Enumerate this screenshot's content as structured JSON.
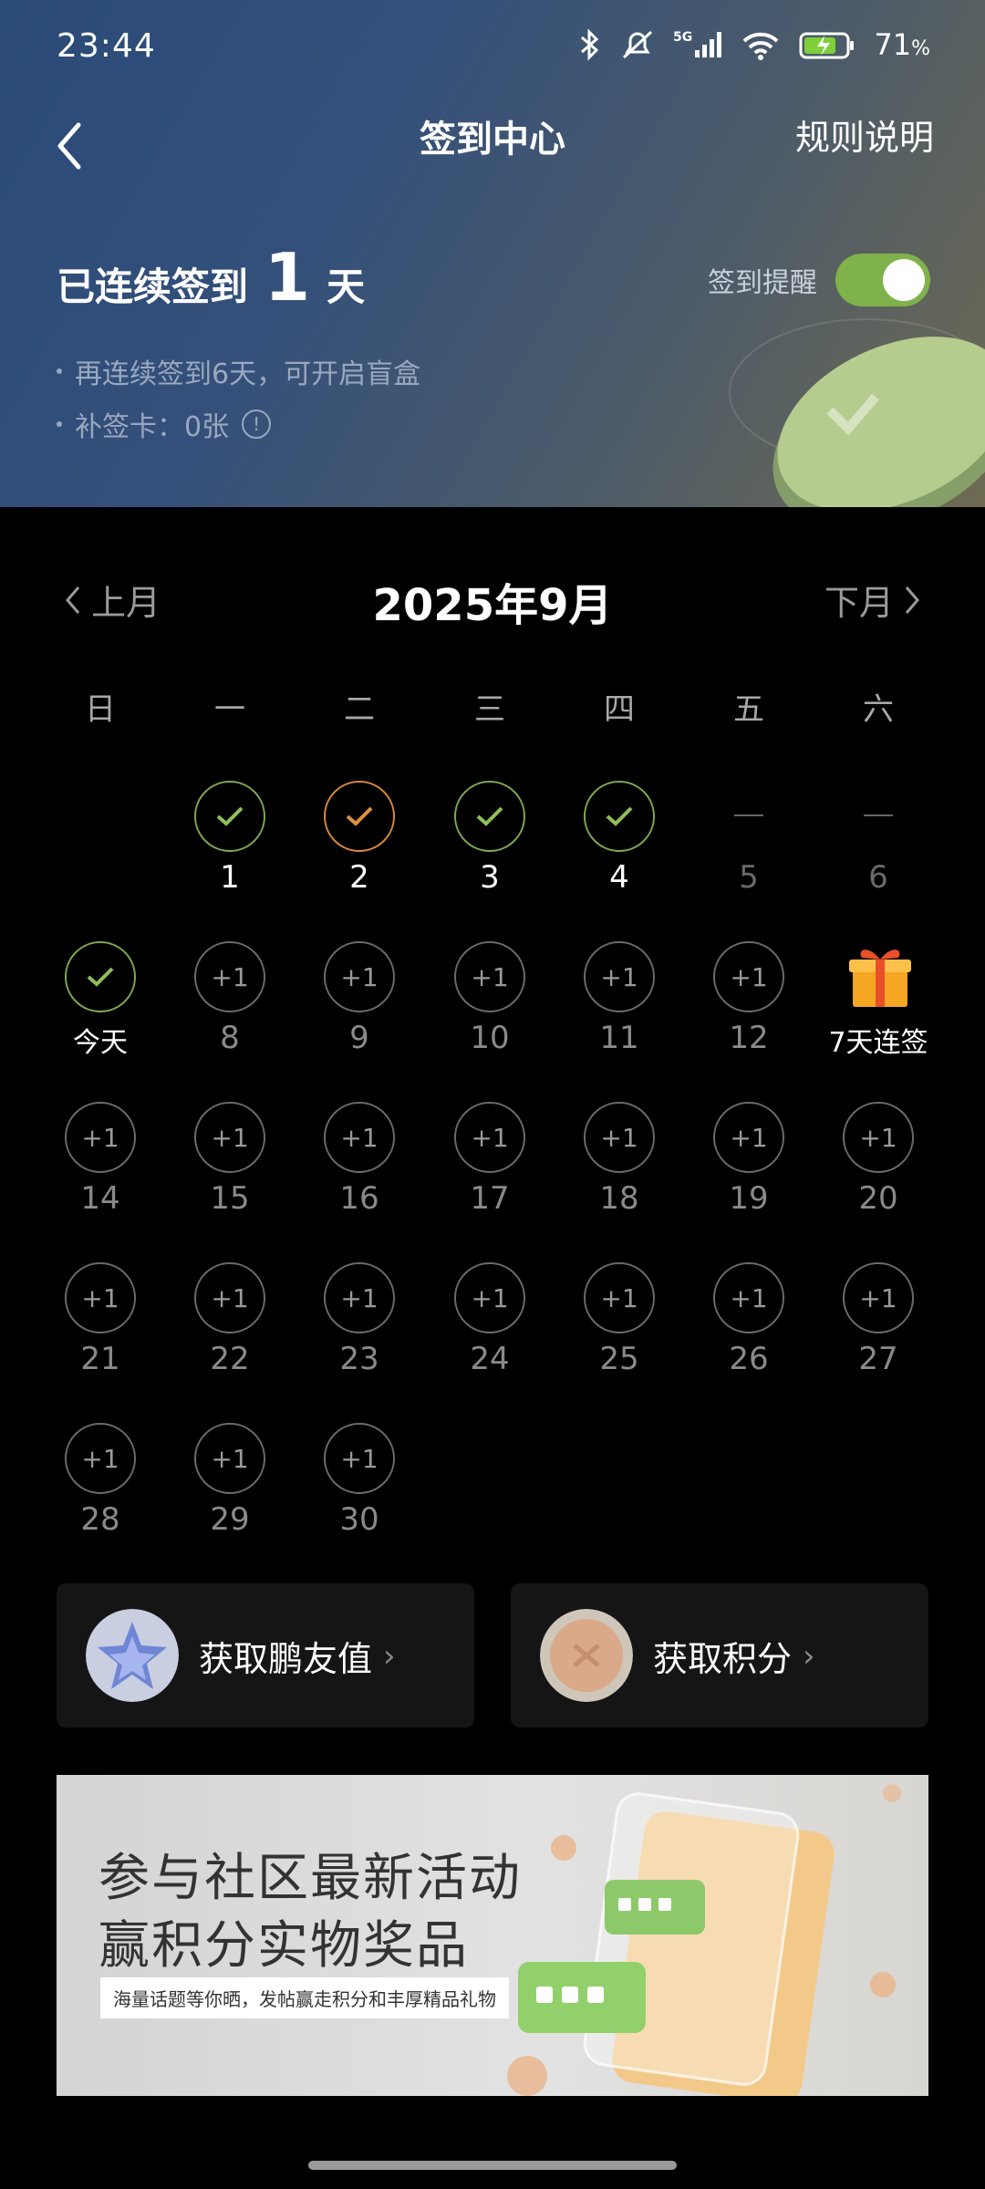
{
  "status_bar": {
    "time": "23:44",
    "network": "5G",
    "battery_percent": "71",
    "battery_unit": "%"
  },
  "nav": {
    "title": "签到中心",
    "rules": "规则说明"
  },
  "streak": {
    "label": "已连续签到",
    "count": "1",
    "unit": "天",
    "tip1": "再连续签到6天，可开启盲盒",
    "tip2": "补签卡：0张",
    "reminder_label": "签到提醒",
    "reminder_on": true
  },
  "calendar": {
    "prev": "上月",
    "next": "下月",
    "month": "2025年9月",
    "weekdays": [
      "日",
      "一",
      "二",
      "三",
      "四",
      "五",
      "六"
    ],
    "week1": [
      {
        "day": "1",
        "state": "checked"
      },
      {
        "day": "2",
        "state": "checked-makeup"
      },
      {
        "day": "3",
        "state": "checked"
      },
      {
        "day": "4",
        "state": "checked"
      },
      {
        "day": "5",
        "state": "empty"
      },
      {
        "day": "6",
        "state": "empty"
      }
    ],
    "today_label": "今天",
    "plus_label": "+1",
    "gift_label": "7天连签",
    "days": [
      "8",
      "9",
      "10",
      "11",
      "12",
      "14",
      "15",
      "16",
      "17",
      "18",
      "19",
      "20",
      "21",
      "22",
      "23",
      "24",
      "25",
      "26",
      "27",
      "28",
      "29",
      "30"
    ]
  },
  "cards": {
    "left": "获取鹏友值",
    "right": "获取积分",
    "chevron": "›"
  },
  "banner": {
    "line1": "参与社区最新活动",
    "line2": "赢积分实物奖品",
    "sub": "海量话题等你晒，发帖赢走积分和丰厚精品礼物"
  },
  "colors": {
    "accent_green": "#7fb24a",
    "check_green": "#7fa650",
    "makeup_orange": "#d8883a"
  }
}
